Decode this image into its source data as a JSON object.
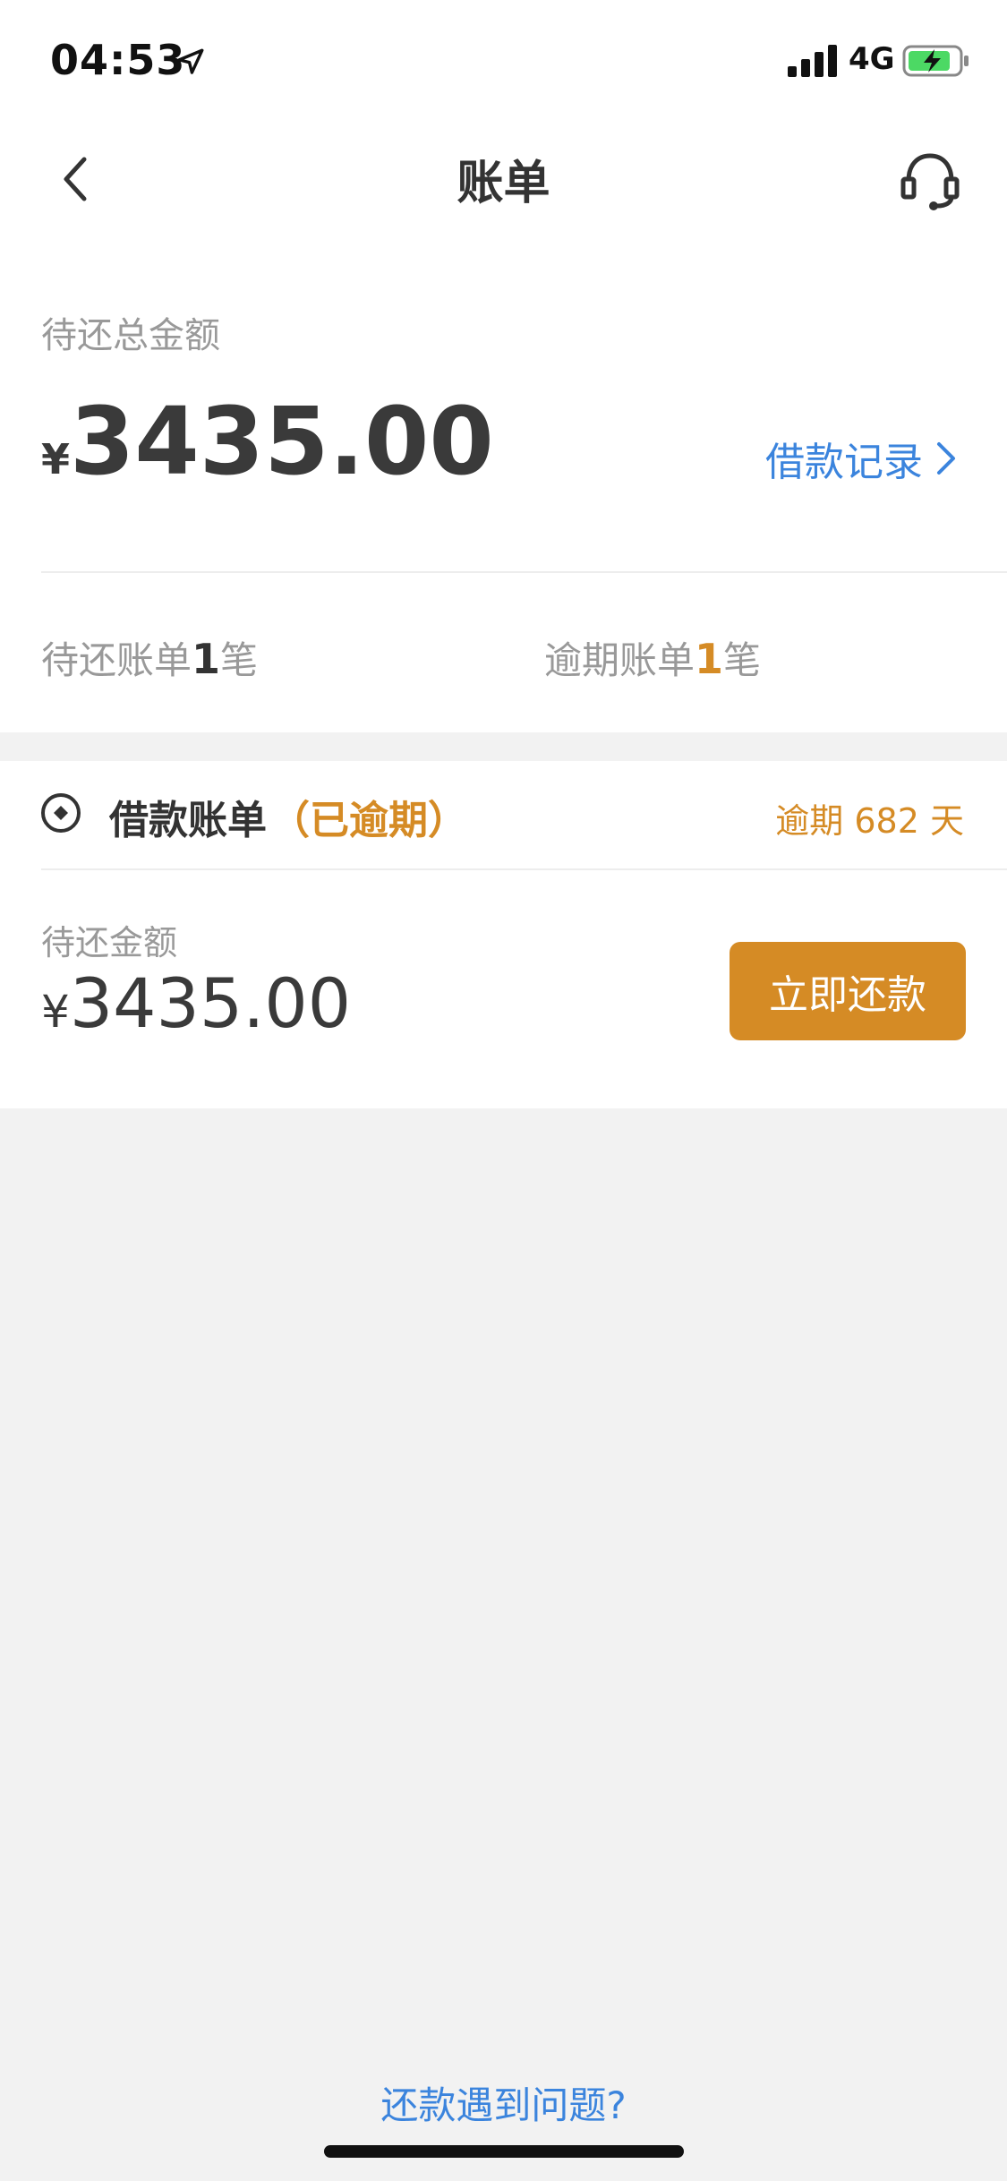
{
  "status_bar": {
    "time": "04:53",
    "network": "4G",
    "icons": [
      "location-arrow-icon",
      "signal-icon",
      "battery-charging-icon"
    ]
  },
  "nav": {
    "title": "账单",
    "back_icon": "chevron-left-icon",
    "service_icon": "headset-icon"
  },
  "summary": {
    "label": "待还总金额",
    "currency": "¥",
    "amount": "3435.00",
    "loan_record_label": "借款记录",
    "pending_prefix": "待还账单",
    "pending_count": "1",
    "pending_suffix": "笔",
    "overdue_prefix": "逾期账单",
    "overdue_count": "1",
    "overdue_suffix": "笔"
  },
  "bill": {
    "icon": "coin-icon",
    "title": "借款账单",
    "status_tag": "（已逾期）",
    "overdue_days": "逾期 682 天",
    "amount_label": "待还金额",
    "currency": "¥",
    "amount": "3435.00",
    "repay_button": "立即还款"
  },
  "footer": {
    "help_link": "还款遇到问题?"
  },
  "colors": {
    "accent_blue": "#3b84dd",
    "accent_orange": "#d58b25",
    "background": "#f2f2f2",
    "card": "#ffffff"
  }
}
